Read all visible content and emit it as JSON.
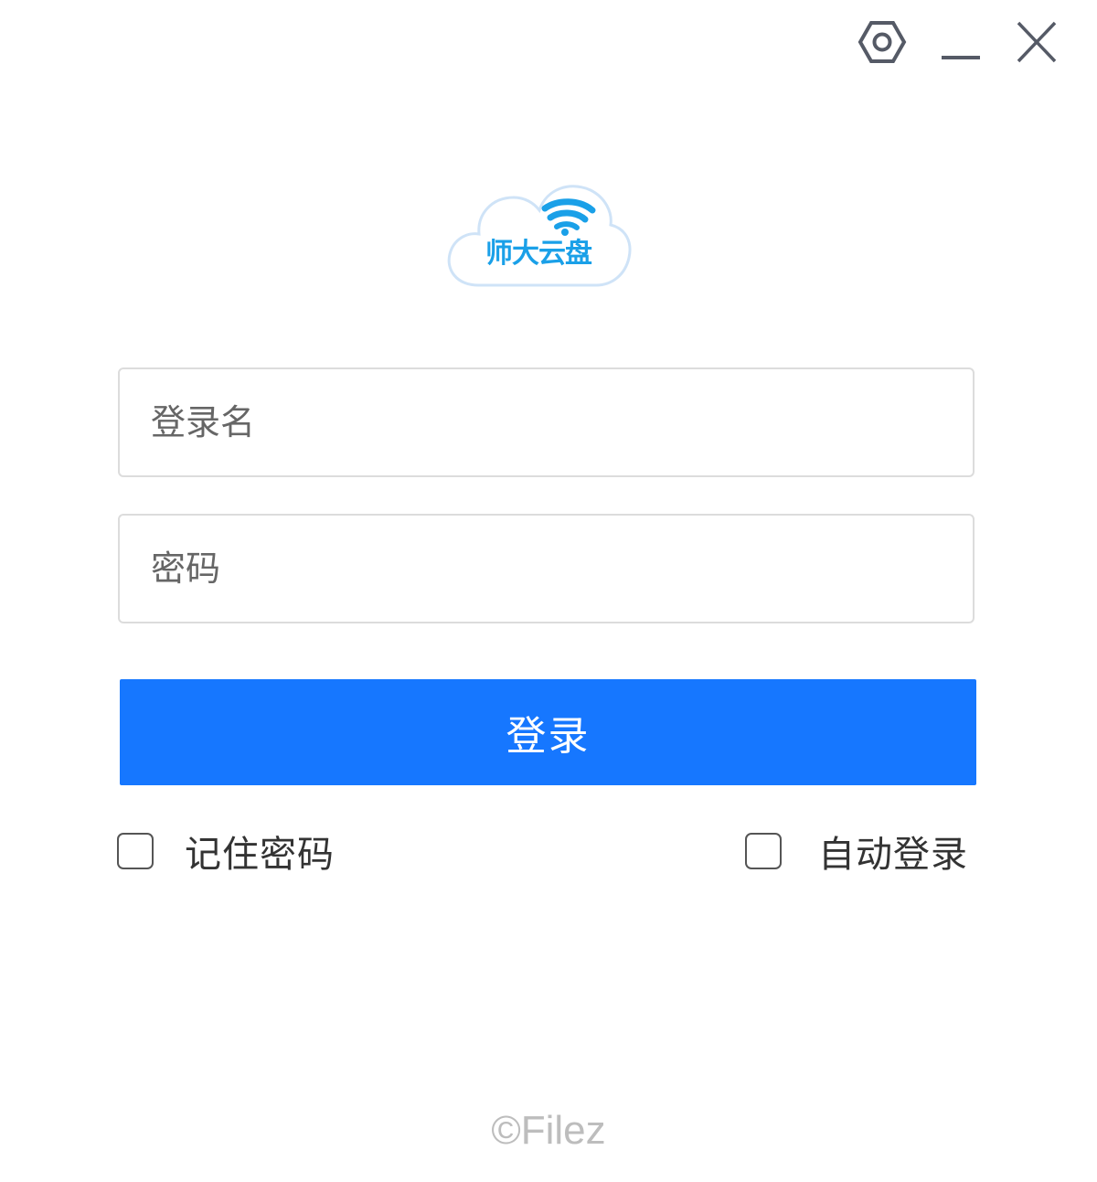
{
  "window": {
    "controls": {
      "settings_icon": "settings-hexagon-icon",
      "minimize_icon": "minimize-icon",
      "close_icon": "close-icon"
    }
  },
  "logo": {
    "text": "师大云盘",
    "icon": "cloud-wifi-icon",
    "color": "#1aa0e8"
  },
  "form": {
    "username": {
      "placeholder": "登录名",
      "value": ""
    },
    "password": {
      "placeholder": "密码",
      "value": ""
    },
    "login_button": "登录",
    "remember_password": {
      "label": "记住密码",
      "checked": false
    },
    "auto_login": {
      "label": "自动登录",
      "checked": false
    }
  },
  "footer": {
    "copyright": "©Filez"
  },
  "colors": {
    "accent": "#1677ff",
    "border": "#dcdcdc",
    "footer_text": "#bdbdbd"
  }
}
